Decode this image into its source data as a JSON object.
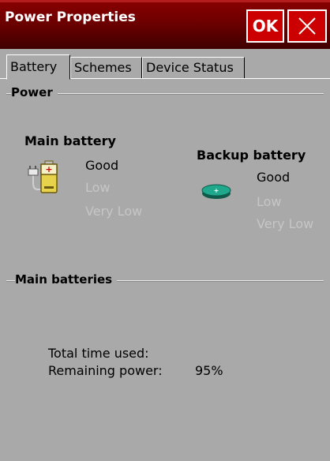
{
  "window": {
    "title": "Power Properties",
    "ok_label": "OK",
    "close_icon": "close-icon"
  },
  "tabs": [
    {
      "label": "Battery",
      "active": true
    },
    {
      "label": "Schemes",
      "active": false
    },
    {
      "label": "Device Status",
      "active": false
    }
  ],
  "power_group": {
    "title": "Power"
  },
  "main_battery": {
    "heading": "Main battery",
    "icon": "battery-plug-icon",
    "levels": [
      {
        "label": "Good",
        "active": true
      },
      {
        "label": "Low",
        "active": false
      },
      {
        "label": "Very Low",
        "active": false
      }
    ]
  },
  "backup_battery": {
    "heading": "Backup battery",
    "icon": "coin-cell-battery-icon",
    "levels": [
      {
        "label": "Good",
        "active": true
      },
      {
        "label": "Low",
        "active": false
      },
      {
        "label": "Very Low",
        "active": false
      }
    ]
  },
  "main_batteries_group": {
    "title": "Main batteries",
    "total_time_label": "Total time used:",
    "total_time_value": "",
    "remaining_label": "Remaining power:",
    "remaining_value": "95%"
  },
  "colors": {
    "title_bar": "#6a0000",
    "button_red": "#cc0000",
    "background": "#a9a9a9",
    "inactive_text": "#c6c6c6"
  }
}
